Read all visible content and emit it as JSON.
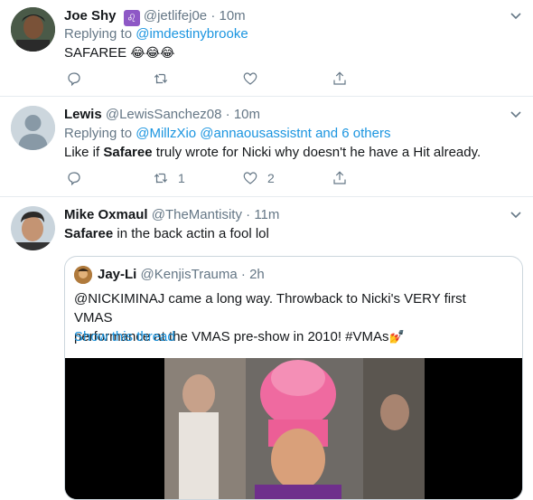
{
  "tweets": [
    {
      "name": "Joe Shy",
      "badge": "♌",
      "handle": "@jetlifej0e",
      "dot": "·",
      "time": "10m",
      "replying_prefix": "Replying to",
      "replying_to": "@imdestinybrooke",
      "text": "SAFAREE",
      "emoji": "😂😂😂",
      "retweet_count": "",
      "like_count": ""
    },
    {
      "name": "Lewis",
      "handle": "@LewisSanchez08",
      "dot": "·",
      "time": "10m",
      "replying_prefix": "Replying to",
      "replying_to": "@MillzXio @annaousassistnt and 6 others",
      "text_pre": "Like if ",
      "text_bold": "Safaree",
      "text_post": " truly wrote for Nicki why doesn't he have a Hit already.",
      "retweet_count": "1",
      "like_count": "2"
    },
    {
      "name": "Mike Oxmaul",
      "handle": "@TheMantisity",
      "dot": "·",
      "time": "11m",
      "text_bold": "Safaree",
      "text_post": " in the back actin a fool lol",
      "quote": {
        "name": "Jay-Li",
        "handle": "@KenjisTrauma",
        "dot": "·",
        "time": "2h",
        "line1": "@NICKIMINAJ came a long way. Throwback to Nicki's VERY first VMAS",
        "line2": "performance at the VMAS pre-show in 2010! #VMAs",
        "line2_emoji": "💅",
        "show_thread": "Show this thread"
      }
    }
  ],
  "icons": [
    "reply-icon",
    "retweet-icon",
    "like-icon",
    "share-icon",
    "caret-down-icon"
  ],
  "colors": {
    "link": "#1b95e0",
    "secondary": "#657786",
    "border": "#e6ecf0"
  }
}
